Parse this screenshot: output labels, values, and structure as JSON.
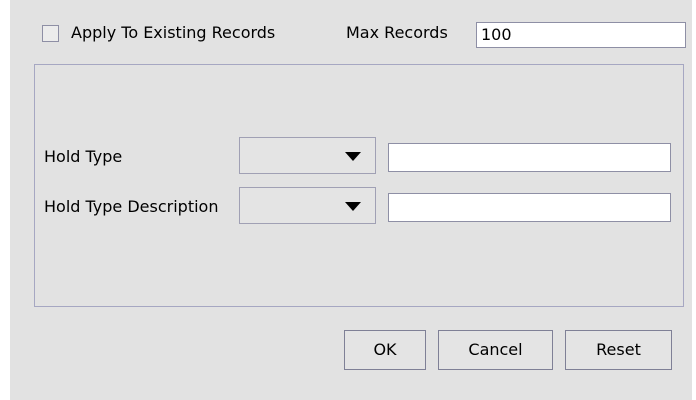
{
  "options": {
    "apply_existing_label": "Apply To Existing Records",
    "apply_existing_checked": false,
    "max_records_label": "Max Records",
    "max_records_value": "100"
  },
  "fields": [
    {
      "label": "Hold Type",
      "operator": "",
      "value": ""
    },
    {
      "label": "Hold Type Description",
      "operator": "",
      "value": ""
    }
  ],
  "buttons": {
    "ok": "OK",
    "cancel": "Cancel",
    "reset": "Reset"
  }
}
